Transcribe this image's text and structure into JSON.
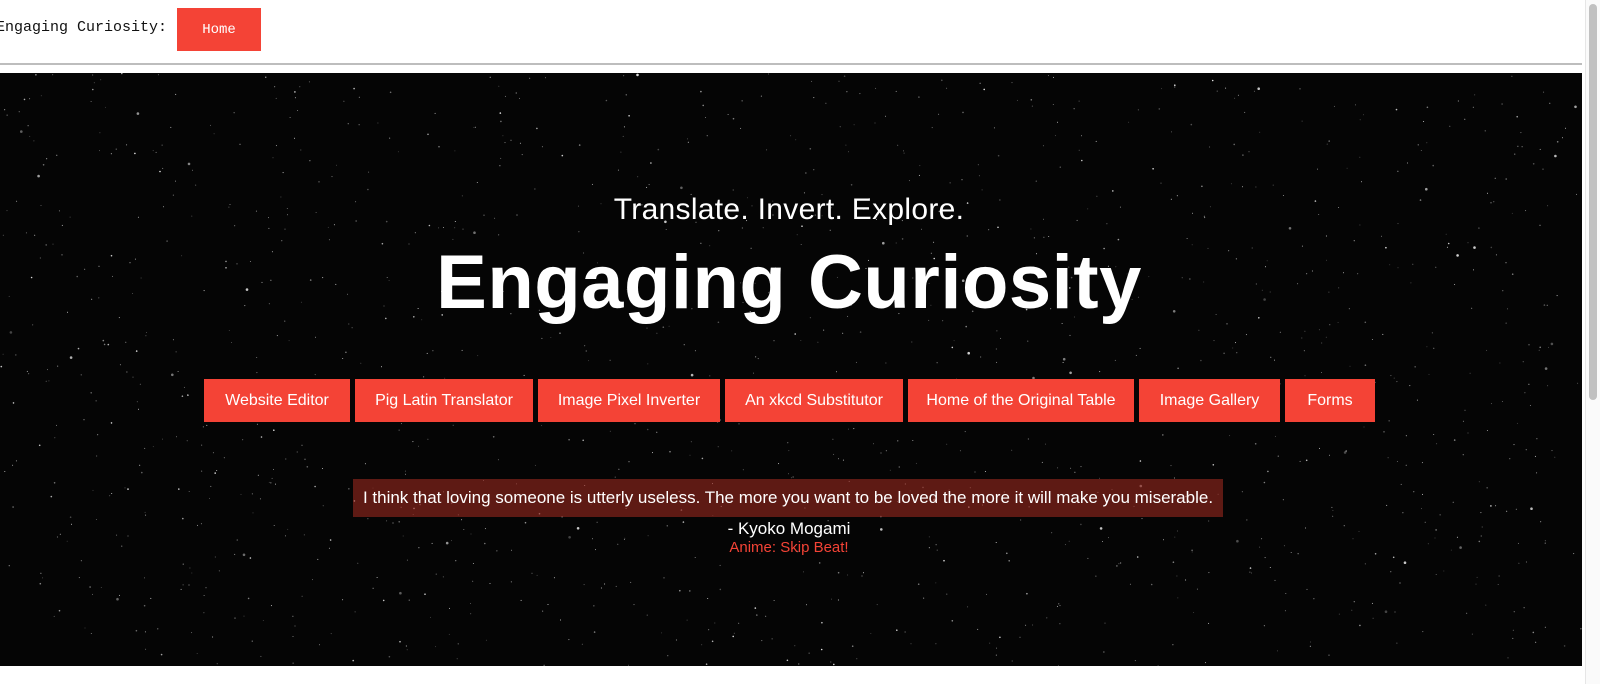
{
  "header": {
    "brand": "Engaging Curiosity:",
    "home_label": "Home"
  },
  "hero": {
    "tagline": "Translate. Invert. Explore.",
    "title": "Engaging Curiosity"
  },
  "nav": {
    "items": [
      {
        "label": "Website Editor"
      },
      {
        "label": "Pig Latin Translator"
      },
      {
        "label": "Image Pixel Inverter"
      },
      {
        "label": "An xkcd Substitutor"
      },
      {
        "label": "Home of the Original Table"
      },
      {
        "label": "Image Gallery"
      },
      {
        "label": "Forms"
      }
    ]
  },
  "quote": {
    "text": "I think that loving someone is utterly useless. The more you want to be loved the more it will make you miserable.",
    "author": "- Kyoko Mogami",
    "source": "Anime: Skip Beat!"
  },
  "colors": {
    "accent": "#f44336",
    "hero_background": "#050505",
    "quote_background": "#8a2a20"
  }
}
